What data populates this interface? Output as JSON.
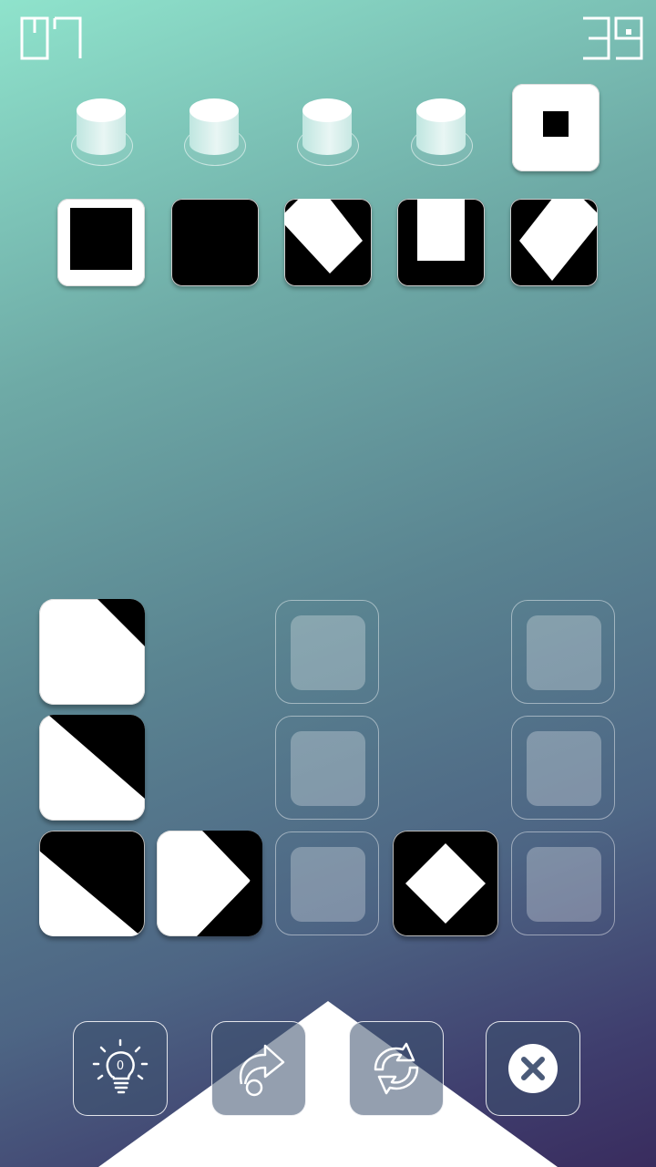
{
  "counters": {
    "level": "07",
    "moves": "39"
  },
  "colors": {
    "tile_white": "#ffffff",
    "tile_black": "#000000",
    "accent": "#ffffff"
  },
  "pegs": [
    {
      "type": "peg"
    },
    {
      "type": "peg"
    },
    {
      "type": "peg"
    },
    {
      "type": "peg"
    },
    {
      "type": "tile",
      "pattern": "small-center-square",
      "base": "white"
    }
  ],
  "target_row": [
    {
      "pattern": "framed-black-square",
      "base": "white"
    },
    {
      "pattern": "solid-black",
      "base": "black"
    },
    {
      "pattern": "white-diamond-right",
      "base": "black"
    },
    {
      "pattern": "white-notch-top",
      "base": "black"
    },
    {
      "pattern": "white-diamond-left",
      "base": "black"
    }
  ],
  "board": [
    [
      "corner-top-right",
      "empty-gap",
      "slot",
      "empty-gap",
      "slot"
    ],
    [
      "half-top-right",
      "empty-gap",
      "slot",
      "empty-gap",
      "slot"
    ],
    [
      "diagonal-top-right-big",
      "arrow-right",
      "slot",
      "diamond-center",
      "slot"
    ]
  ],
  "controls": [
    {
      "name": "hint",
      "icon": "lightbulb-icon",
      "hint_count": "0"
    },
    {
      "name": "skip",
      "icon": "skip-arrow-icon"
    },
    {
      "name": "restart",
      "icon": "refresh-icon"
    },
    {
      "name": "close",
      "icon": "close-icon"
    }
  ]
}
